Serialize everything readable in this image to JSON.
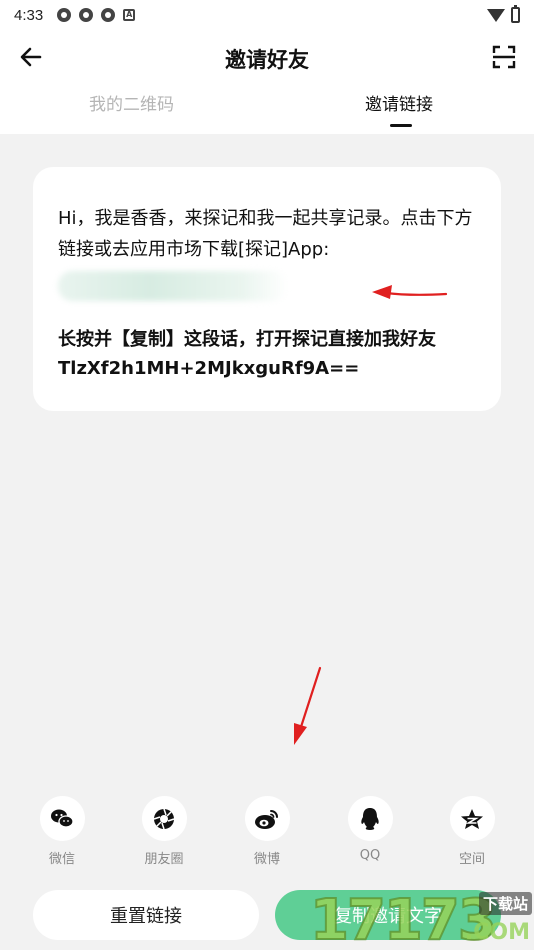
{
  "status_bar": {
    "time": "4:33"
  },
  "header": {
    "title": "邀请好友",
    "tabs": [
      {
        "label": "我的二维码",
        "active": false
      },
      {
        "label": "邀请链接",
        "active": true
      }
    ]
  },
  "card": {
    "message": "Hi，我是香香，来探记和我一起共享记录。点击下方链接或去应用市场下载[探记]App:",
    "command": "长按并【复制】这段话，打开探记直接加我好友 TlzXf2h1MH+2MJkxguRf9A=="
  },
  "share": [
    {
      "label": "微信",
      "icon": "wechat-icon"
    },
    {
      "label": "朋友圈",
      "icon": "moments-icon"
    },
    {
      "label": "微博",
      "icon": "weibo-icon"
    },
    {
      "label": "QQ",
      "icon": "qq-icon"
    },
    {
      "label": "空间",
      "icon": "qzone-icon"
    }
  ],
  "buttons": {
    "reset": "重置链接",
    "copy": "复制邀请文字"
  },
  "watermark": {
    "number": "17173",
    "label": "下载站",
    "domain": ".COM"
  },
  "colors": {
    "accent": "#5fcf96",
    "annotation": "#e02020",
    "background": "#f2f2f2"
  }
}
